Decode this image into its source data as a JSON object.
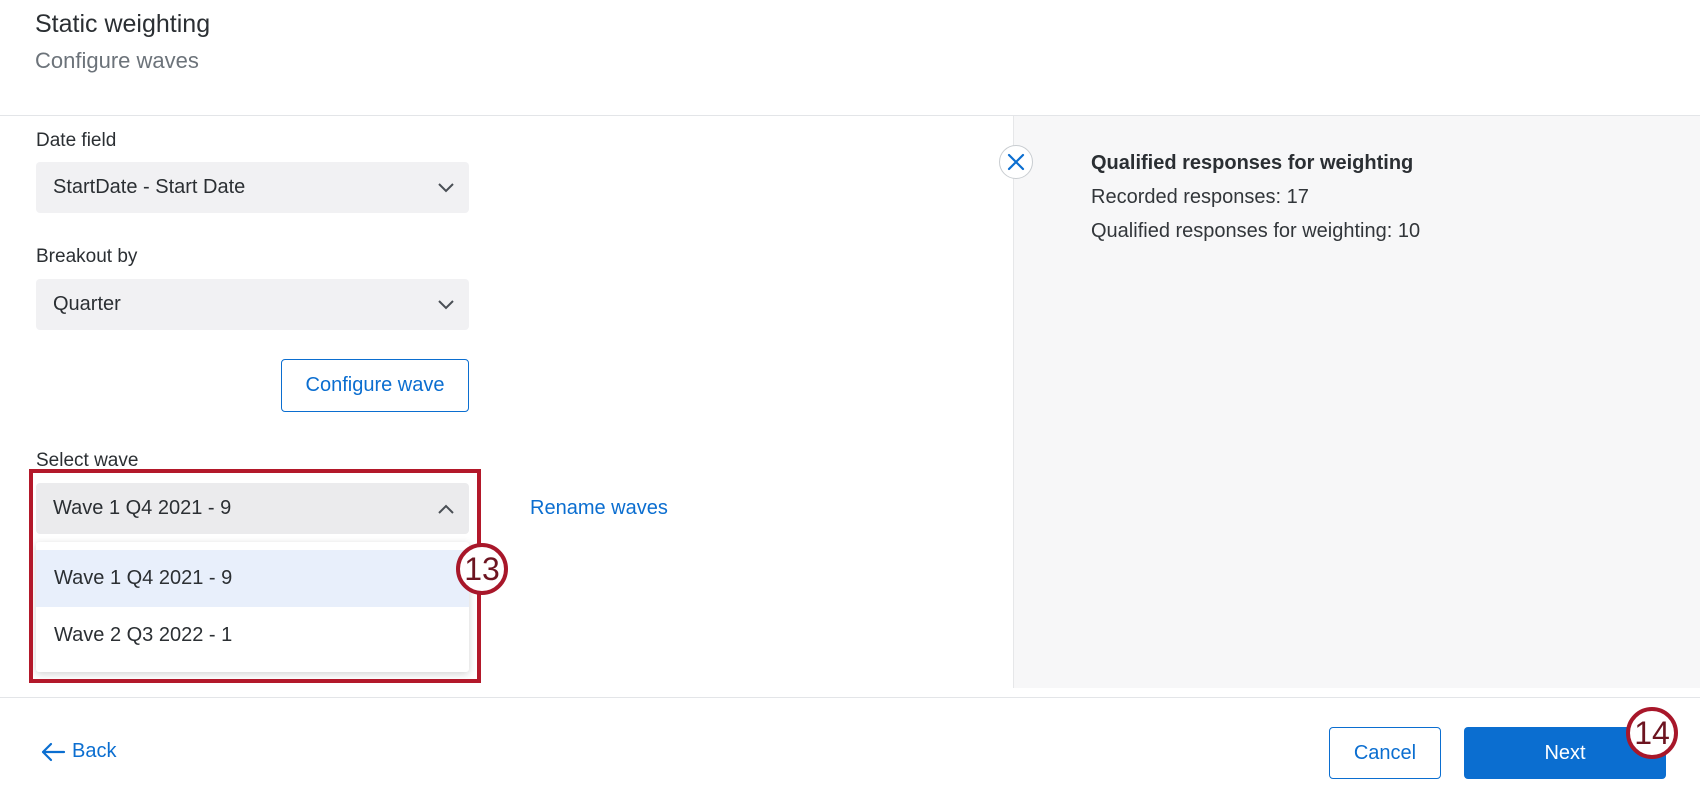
{
  "header": {
    "title": "Static weighting",
    "subtitle": "Configure waves"
  },
  "form": {
    "date_field": {
      "label": "Date field",
      "value": "StartDate - Start Date"
    },
    "breakout": {
      "label": "Breakout by",
      "value": "Quarter"
    },
    "configure_wave_label": "Configure wave",
    "select_wave": {
      "label": "Select wave",
      "value": "Wave 1 Q4 2021 - 9",
      "options": [
        "Wave 1 Q4 2021 - 9",
        "Wave 2 Q3 2022 - 1"
      ]
    },
    "rename_waves_label": "Rename waves"
  },
  "summary_panel": {
    "title": "Qualified responses for weighting",
    "recorded": "Recorded responses: 17",
    "qualified": "Qualified responses for weighting: 10"
  },
  "annotations": {
    "step_13": "13",
    "step_14": "14"
  },
  "footer": {
    "back_label": "Back",
    "cancel_label": "Cancel",
    "next_label": "Next"
  },
  "colors": {
    "accent": "#0b6ed0",
    "annotation_red": "#b3182a",
    "selected_item_bg": "#e8effb"
  }
}
